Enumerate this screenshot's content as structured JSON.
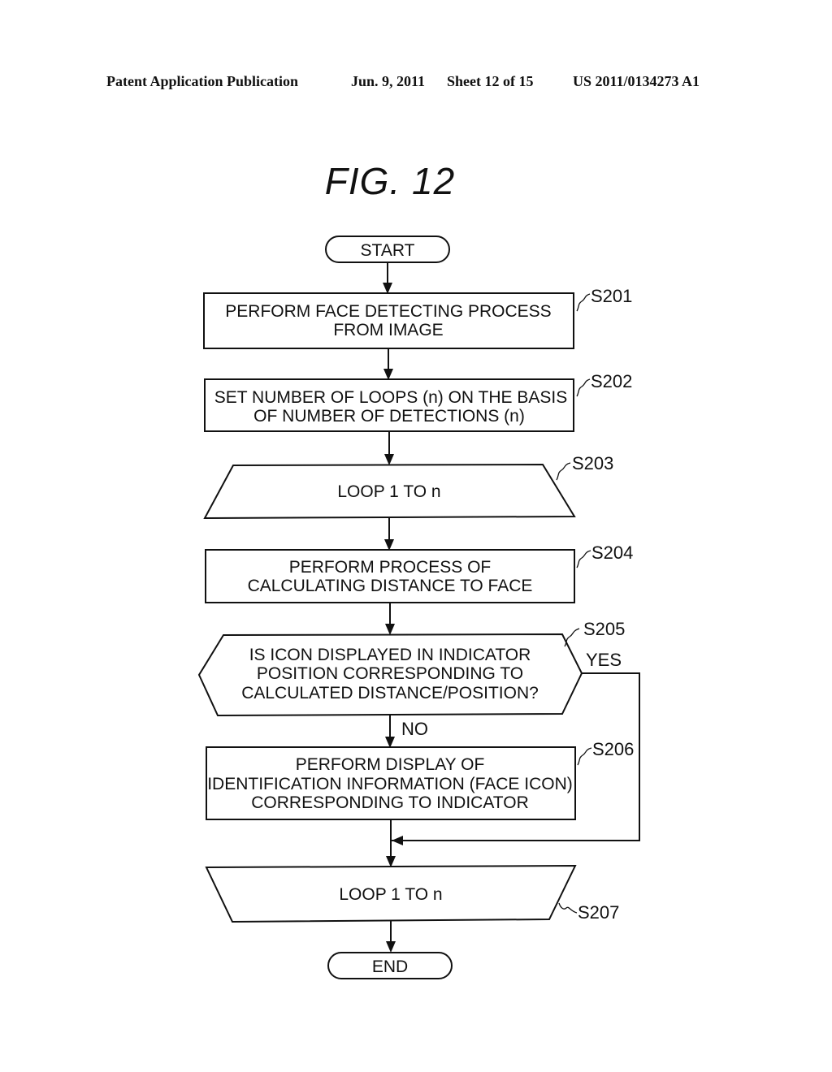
{
  "header": {
    "publication": "Patent Application Publication",
    "date": "Jun. 9, 2011",
    "sheet": "Sheet 12 of 15",
    "number": "US 2011/0134273 A1"
  },
  "figure_title": "FIG.  12",
  "flowchart": {
    "start": "START",
    "end": "END",
    "steps": {
      "s201": {
        "id": "S201",
        "lines": [
          "PERFORM FACE DETECTING PROCESS",
          "FROM IMAGE"
        ]
      },
      "s202": {
        "id": "S202",
        "lines": [
          "SET NUMBER OF LOOPS (n) ON THE BASIS",
          "OF NUMBER OF DETECTIONS (n)"
        ]
      },
      "s203": {
        "id": "S203",
        "lines": [
          "LOOP 1 TO n"
        ]
      },
      "s204": {
        "id": "S204",
        "lines": [
          "PERFORM PROCESS OF",
          "CALCULATING DISTANCE TO FACE"
        ]
      },
      "s205": {
        "id": "S205",
        "lines": [
          "IS ICON DISPLAYED IN INDICATOR",
          "POSITION CORRESPONDING TO",
          "CALCULATED DISTANCE/POSITION?"
        ]
      },
      "s206": {
        "id": "S206",
        "lines": [
          "PERFORM DISPLAY OF",
          "IDENTIFICATION INFORMATION (FACE ICON)",
          "CORRESPONDING TO INDICATOR"
        ]
      },
      "s207": {
        "id": "S207",
        "lines": [
          "LOOP 1 TO n"
        ]
      }
    },
    "branches": {
      "yes": "YES",
      "no": "NO"
    }
  }
}
